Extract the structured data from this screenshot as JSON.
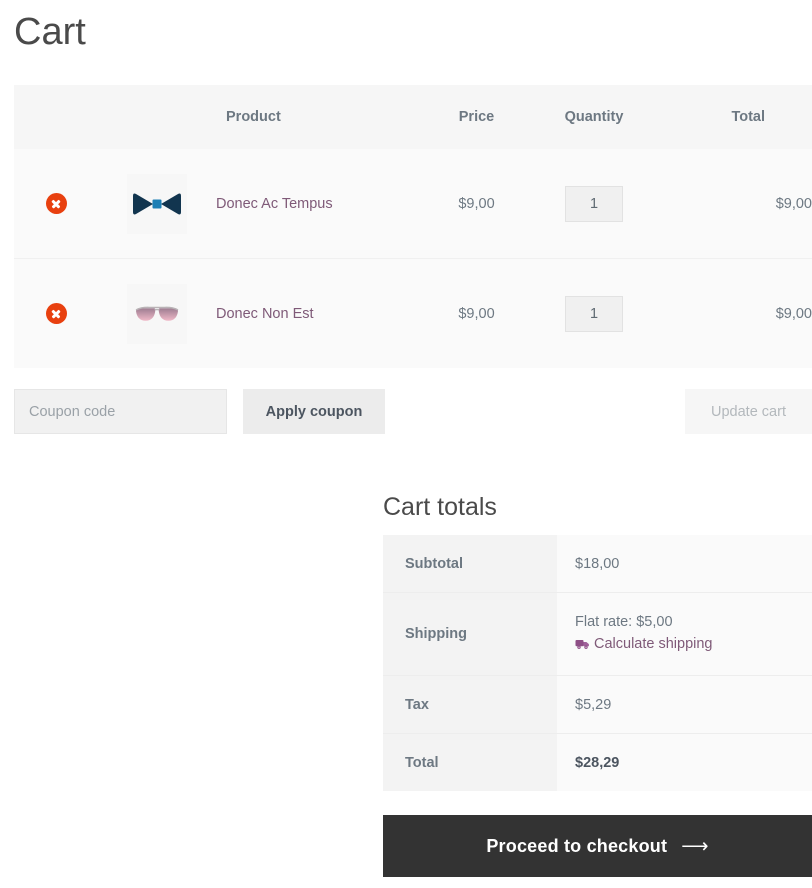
{
  "page": {
    "title": "Cart"
  },
  "cart_table": {
    "headers": {
      "remove": "",
      "thumbnail": "",
      "product": "Product",
      "price": "Price",
      "quantity": "Quantity",
      "total": "Total"
    },
    "rows": [
      {
        "remove_icon": "remove-circle-icon",
        "thumbnail_icon": "bow-tie-thumbnail",
        "name": "Donec Ac Tempus",
        "price": "$9,00",
        "quantity": "1",
        "total": "$9,00"
      },
      {
        "remove_icon": "remove-circle-icon",
        "thumbnail_icon": "sunglasses-thumbnail",
        "name": "Donec Non Est",
        "price": "$9,00",
        "quantity": "1",
        "total": "$9,00"
      }
    ]
  },
  "actions": {
    "coupon_placeholder": "Coupon code",
    "coupon_value": "",
    "apply_coupon_label": "Apply coupon",
    "update_cart_label": "Update cart"
  },
  "totals": {
    "title": "Cart totals",
    "subtotal_label": "Subtotal",
    "subtotal_value": "$18,00",
    "shipping_label": "Shipping",
    "shipping_value": "Flat rate: $5,00",
    "calculate_shipping_label": "Calculate shipping",
    "calculate_shipping_icon": "delivery-truck-icon",
    "tax_label": "Tax",
    "tax_value": "$5,29",
    "total_label": "Total",
    "total_value": "$28,29"
  },
  "checkout": {
    "label": "Proceed to checkout",
    "arrow": "⟶"
  },
  "colors": {
    "link_purple": "#7f5a78",
    "remove_red": "#e8400f",
    "checkout_dark": "#333333",
    "header_bg": "#f6f6f6",
    "row_bg": "#fafafa",
    "totals_label_bg": "#f3f3f3"
  }
}
